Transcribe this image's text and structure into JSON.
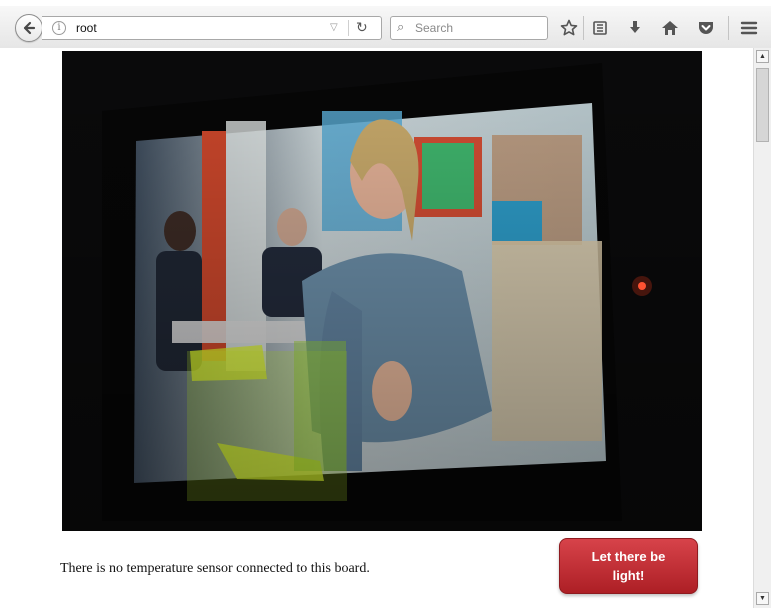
{
  "browser": {
    "url": "root",
    "search_placeholder": "Search"
  },
  "video": {
    "description_icon": "webcam-stream-image"
  },
  "page": {
    "sensor_status": "There is no temperature sensor connected to this board.",
    "light_button_label": "Let there be light!"
  },
  "colors": {
    "button_red": "#c0313a",
    "video_bg": "#0a0a0b"
  }
}
